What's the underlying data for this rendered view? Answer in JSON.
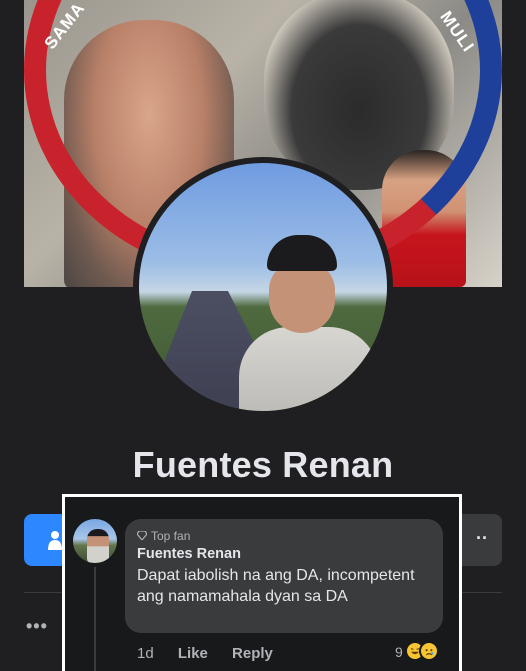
{
  "cover": {
    "ring_text_left": "SAMA",
    "ring_text_right": "MULI",
    "ring_colors": {
      "blue": "#1e3f9a",
      "red": "#c8232c"
    }
  },
  "profile": {
    "name": "Fuentes Renan",
    "accent": "#2d88ff",
    "more_glyph": "··",
    "side_more_glyph": "•••"
  },
  "comment": {
    "badge_icon": "diamond-icon",
    "badge_label": "Top fan",
    "author": "Fuentes Renan",
    "text": "Dapat iabolish na ang DA, incompetent ang namamahala dyan sa DA",
    "time": "1d",
    "like_label": "Like",
    "reply_label": "Reply",
    "reaction_count": "9",
    "reactions": [
      "laugh-emoji",
      "sad-emoji"
    ]
  }
}
